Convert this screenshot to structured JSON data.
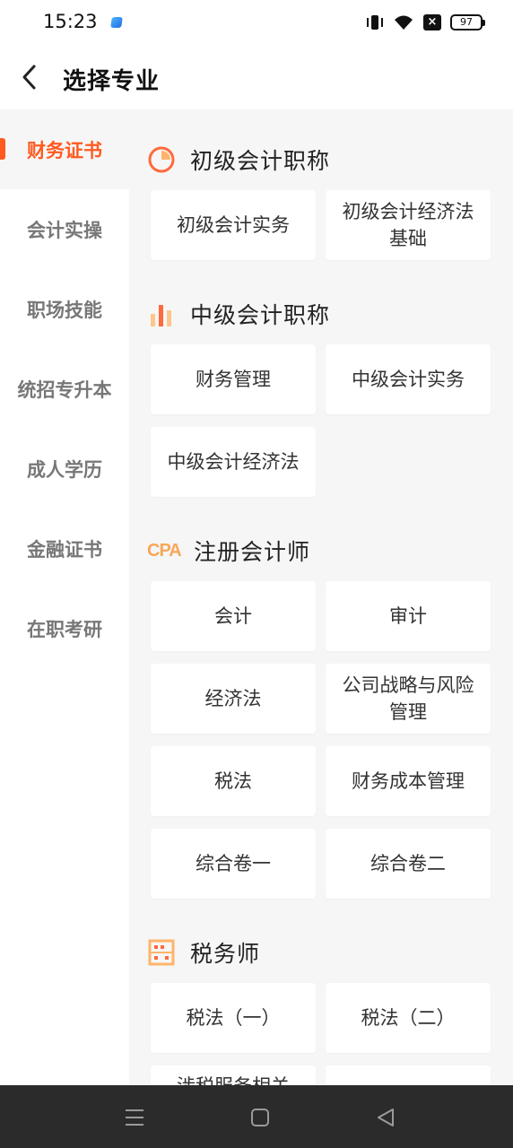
{
  "status": {
    "time": "15:23",
    "battery": "97"
  },
  "header": {
    "title": "选择专业"
  },
  "sidebar": {
    "items": [
      {
        "label": "财务证书",
        "active": true
      },
      {
        "label": "会计实操"
      },
      {
        "label": "职场技能"
      },
      {
        "label": "统招专升本"
      },
      {
        "label": "成人学历"
      },
      {
        "label": "金融证书"
      },
      {
        "label": "在职考研"
      }
    ]
  },
  "sections": [
    {
      "title": "初级会计职称",
      "icon": "pie-chart-icon",
      "courses": [
        "初级会计实务",
        "初级会计经济法基础"
      ]
    },
    {
      "title": "中级会计职称",
      "icon": "bar-chart-icon",
      "courses": [
        "财务管理",
        "中级会计实务",
        "中级会计经济法"
      ]
    },
    {
      "title": "注册会计师",
      "icon": "cpa-icon",
      "icon_text": "CPA",
      "courses": [
        "会计",
        "审计",
        "经济法",
        "公司战略与风险管理",
        "税法",
        "财务成本管理",
        "综合卷一",
        "综合卷二"
      ]
    },
    {
      "title": "税务师",
      "icon": "abacus-icon",
      "courses": [
        "税法（一）",
        "税法（二）",
        "涉税服务相关"
      ]
    }
  ],
  "colors": {
    "accent": "#ff5a1f",
    "icon_orange": "#f7a85a"
  }
}
